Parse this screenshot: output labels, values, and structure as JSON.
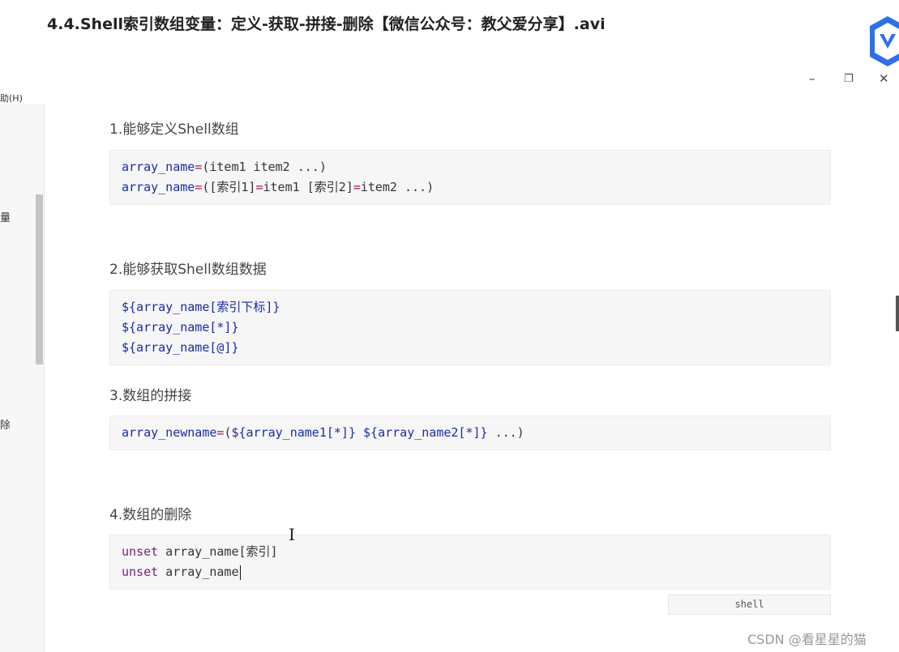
{
  "header": {
    "video_title": "4.4.Shell索引数组变量：定义-获取-拼接-删除【微信公众号：教父爱分享】.avi",
    "window_controls": {
      "minimize": "–",
      "restore": "❐",
      "close": "✕"
    }
  },
  "sidebar": {
    "menu_fragment": "助(H)",
    "side_chars": [
      "量",
      "除"
    ]
  },
  "sections": [
    {
      "title": "1.能够定义Shell数组",
      "code_lines": [
        [
          {
            "t": "array_name",
            "c": "kw"
          },
          {
            "t": "=",
            "c": "op"
          },
          {
            "t": "(item1 item2 ...)",
            "c": "pl"
          }
        ],
        [
          {
            "t": "array_name",
            "c": "kw"
          },
          {
            "t": "=",
            "c": "op"
          },
          {
            "t": "([索引1]",
            "c": "pl"
          },
          {
            "t": "=",
            "c": "op"
          },
          {
            "t": "item1 [索引2]",
            "c": "pl"
          },
          {
            "t": "=",
            "c": "op"
          },
          {
            "t": "item2 ...)",
            "c": "pl"
          }
        ]
      ]
    },
    {
      "title": "2.能够获取Shell数组数据",
      "code_lines": [
        [
          {
            "t": "${array_name[索引下标]}",
            "c": "kw"
          }
        ],
        [
          {
            "t": "${array_name[*]}",
            "c": "kw"
          }
        ],
        [
          {
            "t": "${array_name[@]}",
            "c": "kw"
          }
        ]
      ]
    },
    {
      "title": "3.数组的拼接",
      "code_lines": [
        [
          {
            "t": "array_newname",
            "c": "kw"
          },
          {
            "t": "=",
            "c": "op"
          },
          {
            "t": "(",
            "c": "pl"
          },
          {
            "t": "${array_name1[*]}",
            "c": "kw"
          },
          {
            "t": " ",
            "c": "pl"
          },
          {
            "t": "${array_name2[*]}",
            "c": "kw"
          },
          {
            "t": " ...)",
            "c": "pl"
          }
        ]
      ]
    },
    {
      "title": "4.数组的删除",
      "code_lines": [
        [
          {
            "t": "unset",
            "c": "pu"
          },
          {
            "t": " array_name[索引]",
            "c": "pl"
          }
        ],
        [
          {
            "t": "unset",
            "c": "pu"
          },
          {
            "t": " array_name",
            "c": "pl"
          }
        ]
      ]
    }
  ],
  "code_language": "shell",
  "watermark": "CSDN @看星星的猫",
  "colors": {
    "keyword": "#1a2aa6",
    "operator": "#a11a4a",
    "unset_keyword": "#7a1f7a",
    "code_background": "#f6f6f6"
  },
  "icons": [
    "app-logo-icon",
    "minimize-icon",
    "restore-icon",
    "close-icon",
    "text-cursor-icon"
  ]
}
